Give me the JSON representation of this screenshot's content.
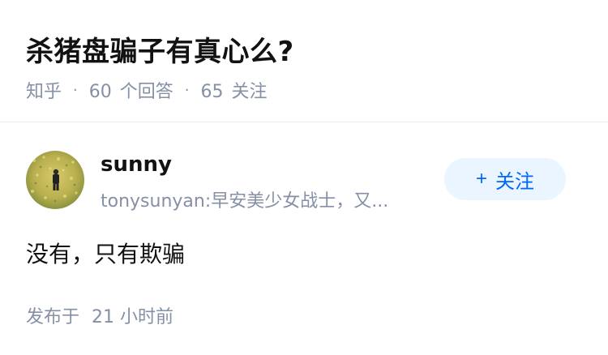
{
  "question": {
    "title": "杀猪盘骗子有真心么?",
    "source": "知乎",
    "separator": "·",
    "answer_count": "60",
    "answer_label": "个回答",
    "follower_count": "65",
    "follower_label": "关注"
  },
  "author": {
    "name": "sunny",
    "bio": "tonysunyan:早安美少女战士，又...",
    "follow_icon": "+",
    "follow_label": "关注"
  },
  "answer": {
    "content": "没有，只有欺骗",
    "published_label": "发布于",
    "published_time": "21 小时前"
  },
  "colors": {
    "accent": "#0066ff",
    "follow_bg": "#ebf5ff",
    "meta_gray": "#8590a6"
  }
}
